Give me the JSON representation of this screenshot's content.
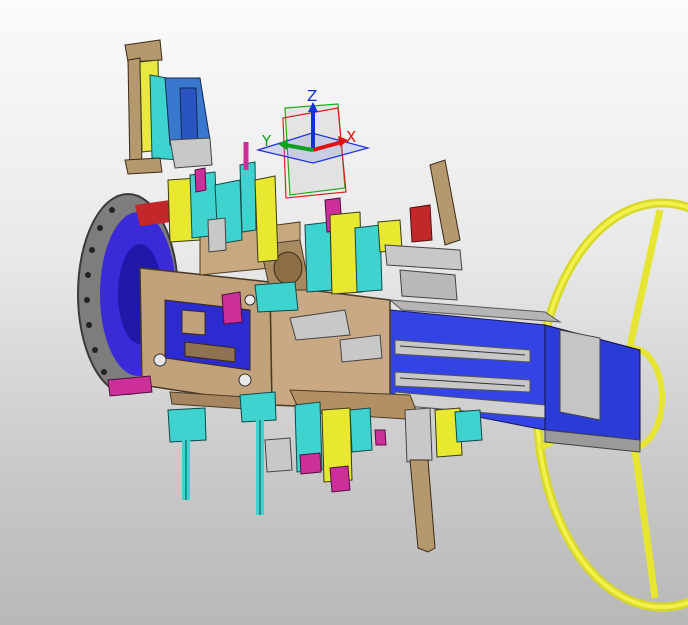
{
  "compass": {
    "x_label": "X",
    "y_label": "Y",
    "z_label": "Z"
  },
  "colors": {
    "background_top": "#fbfbfb",
    "background_bottom": "#b8b8b8",
    "steel_beige": "#c2a27a",
    "fixture_cyan": "#3fd3cf",
    "fixture_yellow": "#ecec30",
    "fixture_magenta": "#cc2f9a",
    "slide_blue": "#2f3fe0",
    "metal_grey": "#b9b9b9",
    "axis_x": "#e01010",
    "axis_y": "#10a020",
    "axis_z": "#1030e0"
  },
  "model": {
    "icons": [
      "3d-compass-icon",
      "assembly-model"
    ]
  }
}
